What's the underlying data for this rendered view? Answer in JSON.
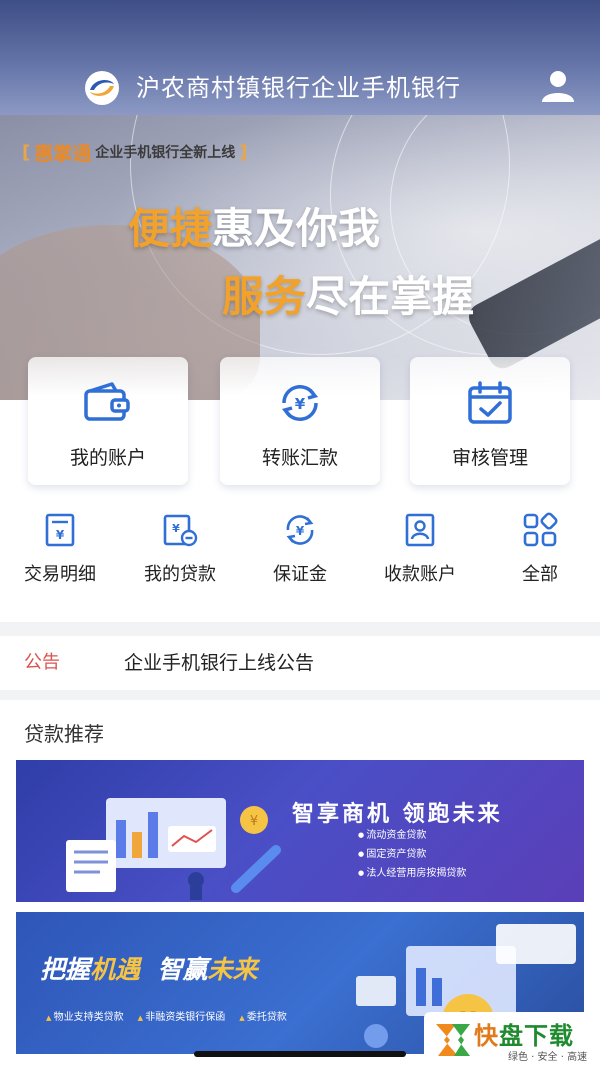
{
  "header": {
    "title": "沪农商村镇银行企业手机银行",
    "logo_icon": "bank-logo",
    "user_icon": "user-icon"
  },
  "banner": {
    "brand": "惠掌通",
    "tagline": "企业手机银行全新上线",
    "slogan_line1_highlight": "便捷",
    "slogan_line1_rest": "惠及你我",
    "slogan_line2_highlight": "服务",
    "slogan_line2_rest": "尽在掌握",
    "highlight_color": "#f2a22b"
  },
  "main_functions": [
    {
      "label": "我的账户",
      "icon": "wallet-icon"
    },
    {
      "label": "转账汇款",
      "icon": "yen-transfer-icon"
    },
    {
      "label": "审核管理",
      "icon": "calendar-check-icon"
    }
  ],
  "quick_functions": [
    {
      "label": "交易明细",
      "icon": "receipt-icon"
    },
    {
      "label": "我的贷款",
      "icon": "loan-icon"
    },
    {
      "label": "保证金",
      "icon": "deposit-icon"
    },
    {
      "label": "收款账户",
      "icon": "payee-account-icon"
    },
    {
      "label": "全部",
      "icon": "all-apps-icon"
    }
  ],
  "notice": {
    "tag": "公告",
    "text": "企业手机银行上线公告"
  },
  "loan_section": {
    "title": "贷款推荐",
    "promo1": {
      "headline": "智享商机  领跑未来",
      "items": [
        "流动资金贷款",
        "固定资产贷款",
        "法人经营用房按揭贷款"
      ]
    },
    "promo2": {
      "headline_part1": "把握",
      "headline_part2": "机遇",
      "headline_part3": "智赢",
      "headline_part4": "未来",
      "items": [
        "物业支持类贷款",
        "非融资类银行保函",
        "委托贷款"
      ]
    }
  },
  "watermark": {
    "title_char1": "快",
    "title_rest": "盘下载",
    "subtitle": "绿色 · 安全 · 高速"
  },
  "colors": {
    "icon_blue": "#2f6fd6",
    "notice_red": "#d9534f",
    "header_blue": "#4a5a92"
  }
}
